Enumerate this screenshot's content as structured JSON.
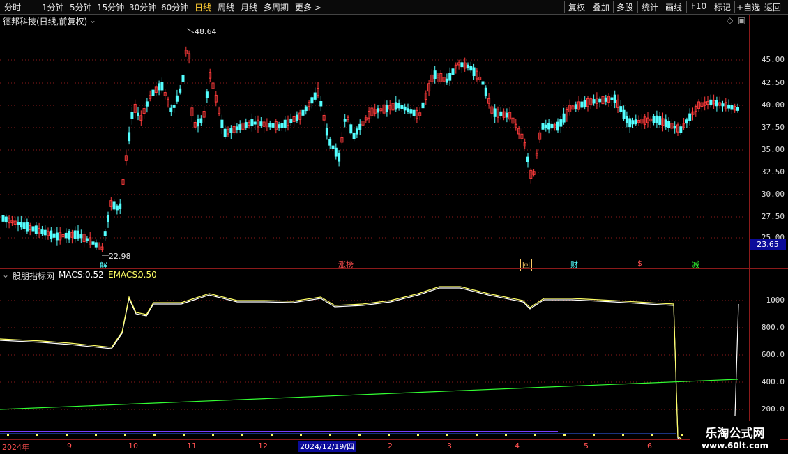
{
  "toolbar": {
    "periods": [
      "分时",
      "1分钟",
      "5分钟",
      "15分钟",
      "30分钟",
      "60分钟",
      "日线",
      "周线",
      "月线",
      "多周期",
      "更多"
    ],
    "active_period": "日线",
    "right_buttons": [
      "复权",
      "叠加",
      "多股",
      "统计",
      "画线",
      "F10",
      "标记",
      "+自选",
      "返回"
    ]
  },
  "main_chart": {
    "stock_title": "德邦科技(日线,前复权)",
    "y_ticks": [
      "45.00",
      "42.50",
      "40.00",
      "37.50",
      "35.00",
      "32.50",
      "30.00",
      "27.50",
      "25.00"
    ],
    "high_label": "48.64",
    "low_label": "22.98",
    "last_price": "23.65",
    "events": [
      "解",
      "涨榜",
      "回",
      "财",
      "$",
      "减"
    ]
  },
  "indicator": {
    "name": "股朋指标网",
    "macs_label": "MACS:",
    "macs_value": "0.52",
    "emacs_label": "EMACS:",
    "emacs_value": "0.50",
    "y_ticks": [
      "1000",
      "800.0",
      "600.0",
      "400.0",
      "200.0"
    ]
  },
  "date_axis": {
    "labels": [
      "2024年",
      "9",
      "10",
      "11",
      "12",
      "2",
      "3",
      "4",
      "5",
      "6"
    ],
    "cursor_date": "2024/12/19/四"
  },
  "watermark": {
    "title": "乐淘公式网",
    "url": "www.60lt.com"
  },
  "colors": {
    "up": "#ff3b3b",
    "down": "#54ffff",
    "macs": "#ffff66",
    "emacs": "#ffffff",
    "trend": "#33ff33",
    "grid": "#8b1a1a"
  }
}
